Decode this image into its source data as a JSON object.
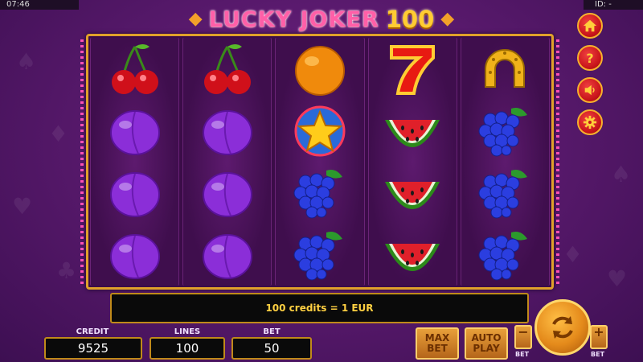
{
  "status_bar": {
    "time": "07:46",
    "id_label": "ID: -"
  },
  "title": {
    "word": "LUCKY JOKER",
    "number": "100"
  },
  "reels": [
    [
      "cherry-icon",
      "plum-icon",
      "plum-icon",
      "plum-icon"
    ],
    [
      "cherry-icon",
      "plum-icon",
      "plum-icon",
      "plum-icon"
    ],
    [
      "orange-icon",
      "star-icon",
      "grapes-icon",
      "grapes-icon"
    ],
    [
      "seven-icon",
      "watermelon-icon",
      "watermelon-icon",
      "watermelon-icon"
    ],
    [
      "horseshoe-icon",
      "grapes-icon",
      "grapes-icon",
      "grapes-icon"
    ]
  ],
  "side_buttons": [
    "home-icon",
    "help-icon",
    "sound-icon",
    "settings-icon"
  ],
  "info": {
    "message": "100 credits = 1 EUR"
  },
  "credit": {
    "label": "CREDIT",
    "value": "9525"
  },
  "lines": {
    "label": "LINES",
    "value": "100"
  },
  "bet": {
    "label": "BET",
    "value": "50"
  },
  "buttons": {
    "max_bet_line1": "MAX",
    "max_bet_line2": "BET",
    "auto_play_line1": "AUTO",
    "auto_play_line2": "PLAY",
    "minus": "−",
    "plus": "+",
    "minus_sub": "BET",
    "plus_sub": "BET"
  },
  "colors": {
    "frame_gold": "#e0a12a",
    "side_button_red": "#c8141a",
    "accent_yellow": "#ffd042"
  }
}
